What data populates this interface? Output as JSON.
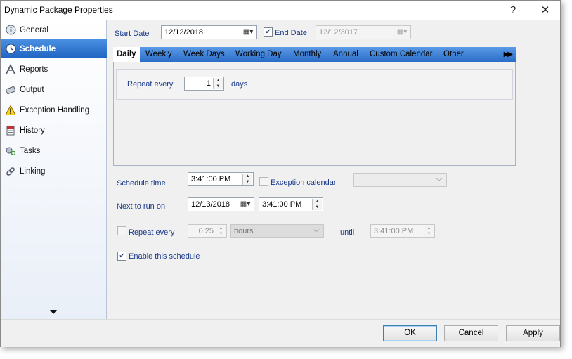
{
  "window": {
    "title": "Dynamic Package Properties",
    "help_label": "?",
    "close_label": "✕"
  },
  "sidebar": {
    "items": [
      {
        "label": "General",
        "icon": "info-icon"
      },
      {
        "label": "Schedule",
        "icon": "clock-icon",
        "active": true
      },
      {
        "label": "Reports",
        "icon": "reports-icon"
      },
      {
        "label": "Output",
        "icon": "output-icon"
      },
      {
        "label": "Exception Handling",
        "icon": "warning-icon"
      },
      {
        "label": "History",
        "icon": "history-icon"
      },
      {
        "label": "Tasks",
        "icon": "tasks-icon"
      },
      {
        "label": "Linking",
        "icon": "linking-icon"
      }
    ]
  },
  "schedule": {
    "start_date_label": "Start Date",
    "start_date_value": "12/12/2018",
    "end_date_label": "End Date",
    "end_date_checked": true,
    "end_date_value": "12/12/3017",
    "tabs": [
      "Daily",
      "Weekly",
      "Week Days",
      "Working Day",
      "Monthly",
      "Annual",
      "Custom Calendar",
      "Other"
    ],
    "active_tab": "Daily",
    "tab_scroll_label": "▶▶",
    "repeat_every_label": "Repeat every",
    "repeat_every_value": "1",
    "repeat_every_unit": "days",
    "schedule_time_label": "Schedule time",
    "schedule_time_value": "3:41:00 PM",
    "exception_calendar_label": "Exception calendar",
    "exception_calendar_checked": false,
    "next_run_label": "Next to run on",
    "next_run_date": "12/13/2018",
    "next_run_time": "3:41:00 PM",
    "repeat_label": "Repeat every",
    "repeat_checked": false,
    "repeat_interval_value": "0.25",
    "repeat_unit_value": "hours",
    "until_label": "until",
    "until_value": "3:41:00 PM",
    "enable_label": "Enable this schedule",
    "enable_checked": true
  },
  "footer": {
    "ok_label": "OK",
    "cancel_label": "Cancel",
    "apply_label": "Apply"
  },
  "colors": {
    "accent": "#1f64c0",
    "tab_bar": "#2a6dc8",
    "label_blue": "#1a3a8a"
  }
}
